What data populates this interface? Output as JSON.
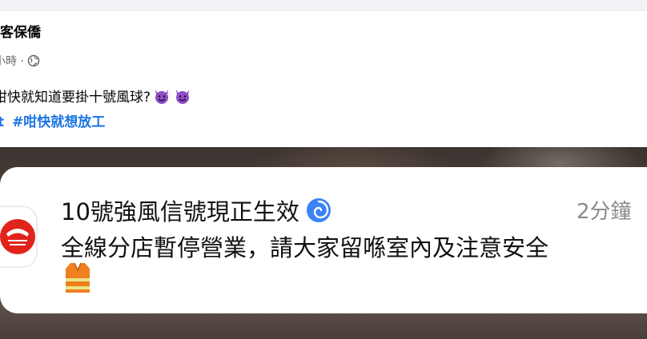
{
  "post": {
    "author": "必勝客保僑",
    "time": "小時 ·",
    "text": "咁快就知道要掛十號風球?",
    "emojis": [
      "smiling-devil-icon",
      "smiling-devil-icon"
    ],
    "hashtags": [
      "t",
      "#咁快就想放工"
    ]
  },
  "notification": {
    "title": "10號強風信號現正生效",
    "title_icon": "cyclone-icon",
    "time": "2分鐘",
    "body": "全線分店暫停營業，請大家留喺室內及注意安全",
    "trailing_icon": "safety-vest-icon",
    "brand_icon": "pizza-hut-logo-icon",
    "brand_color": "#e0231b"
  },
  "colors": {
    "link": "#1b74e4",
    "meta": "#65676b"
  }
}
